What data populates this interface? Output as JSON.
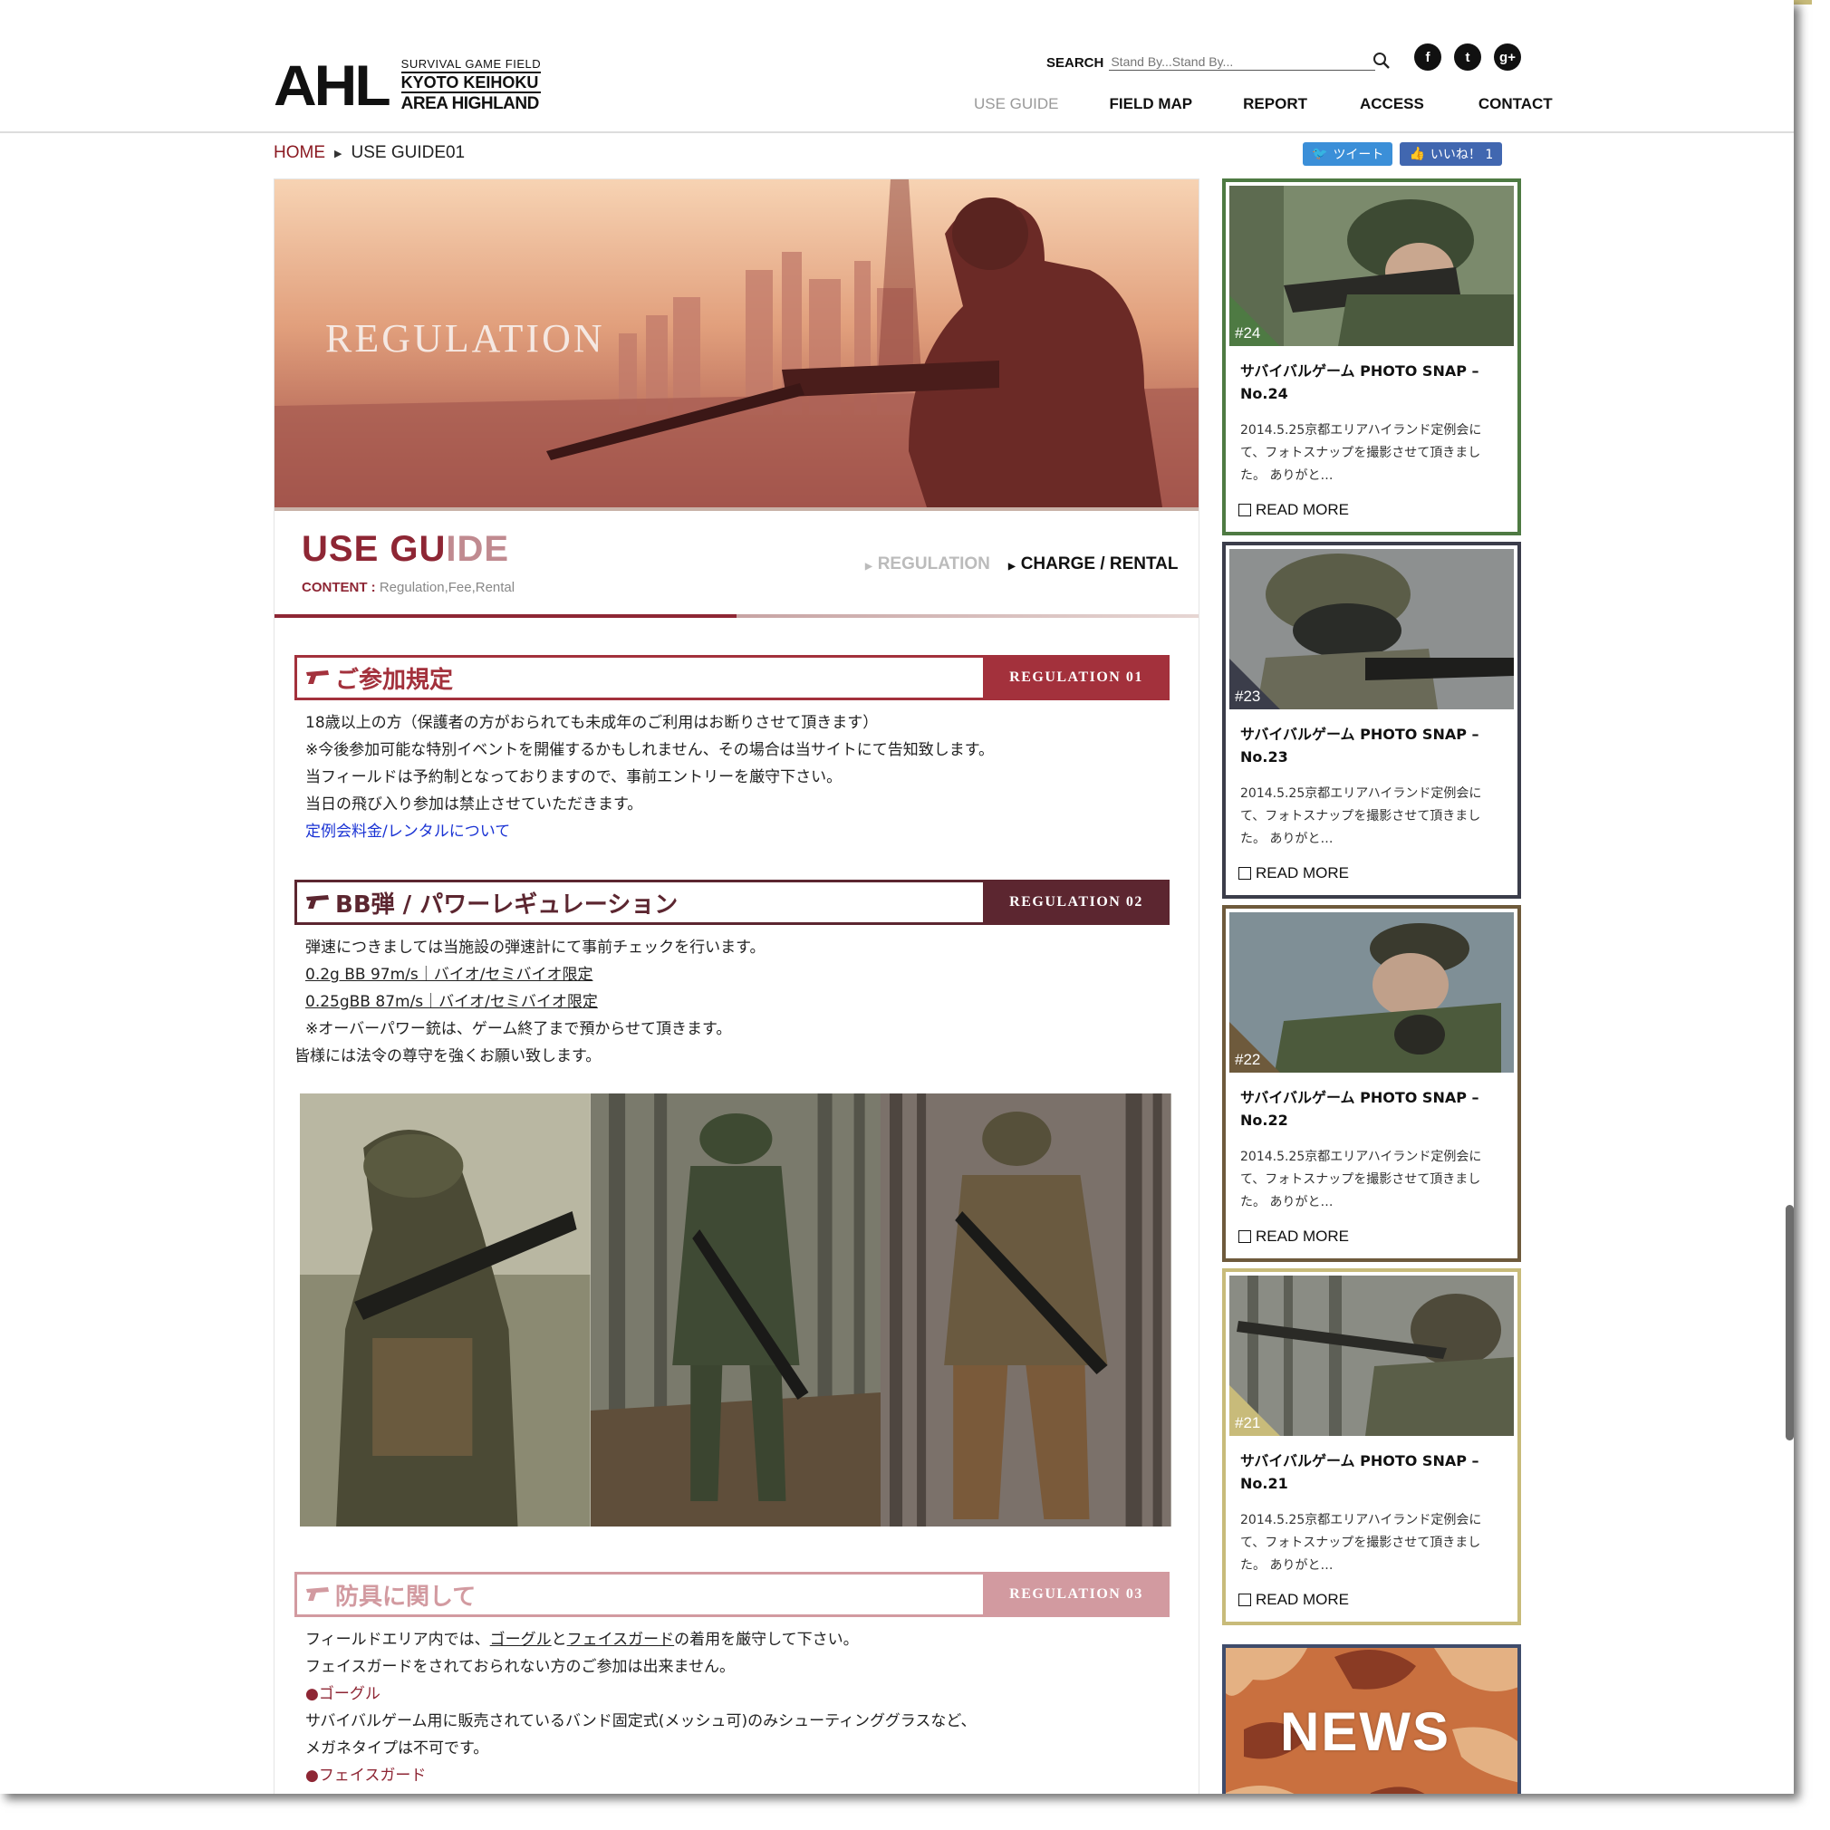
{
  "header": {
    "logo_main": "AHL",
    "logo_line1": "SURVIVAL GAME FIELD",
    "logo_line2": "KYOTO KEIHOKU",
    "logo_line3": "AREA HIGHLAND",
    "search_label": "SEARCH",
    "search_placeholder": "Stand By...Stand By...",
    "social": [
      "f",
      "t",
      "g+"
    ],
    "nav": [
      "USE GUIDE",
      "FIELD MAP",
      "REPORT",
      "ACCESS",
      "CONTACT"
    ]
  },
  "breadcrumb": {
    "home": "HOME",
    "current": "USE GUIDE01"
  },
  "share": {
    "tweet": "ツイート",
    "like": "いいね！ 1"
  },
  "hero": {
    "title": "REGULATION"
  },
  "guide": {
    "title_a": "USE GU",
    "title_b": "IDE",
    "content_label": "CONTENT :",
    "content_value": "Regulation,Fee,Rental",
    "tab1": "REGULATION",
    "tab2": "CHARGE / RENTAL"
  },
  "sections": [
    {
      "title": "ご参加規定",
      "tag": "REGULATION 01",
      "lines": [
        "18歳以上の方（保護者の方がおられても未成年のご利用はお断りさせて頂きます）",
        "※今後参加可能な特別イベントを開催するかもしれません、その場合は当サイトにて告知致します。",
        "当フィールドは予約制となっておりますので、事前エントリーを厳守下さい。",
        "当日の飛び入り参加は禁止させていただきます。"
      ],
      "link": "定例会料金/レンタルについて"
    },
    {
      "title": "BB弾 / パワーレギュレーション",
      "tag": "REGULATION 02",
      "line1": "弾速につきましては当施設の弾速計にて事前チェックを行います。",
      "line2": "0.2g BB 97m/s｜バイオ/セミバイオ限定",
      "line3": "0.25gBB 87m/s｜バイオ/セミバイオ限定",
      "line4": "※オーバーパワー銃は、ゲーム終了まで預からせて頂きます。",
      "line5": "皆様には法令の尊守を強くお願い致します。"
    },
    {
      "title": "防具に関して",
      "tag": "REGULATION 03",
      "l1a": "フィールドエリア内では、",
      "l1b": "ゴーグル",
      "l1c": "と",
      "l1d": "フェイスガード",
      "l1e": "の着用を厳守して下さい。",
      "l2": "フェイスガードをされておられない方のご参加は出来ません。",
      "h1": "●ゴーグル",
      "l3": "サバイバルゲーム用に販売されているバンド固定式(メッシュ可)のみシューティンググラスなど、",
      "l4": "メガネタイプは不可です。",
      "h2": "●フェイスガード"
    }
  ],
  "sidebar": [
    {
      "num": "#24",
      "title": "サバイバルゲーム PHOTO SNAP – No.24",
      "text": "2014.5.25京都エリアハイランド定例会にて、フォトスナップを撮影させて頂きました。 ありがと…",
      "more": "READ MORE",
      "color": "#4e7a43"
    },
    {
      "num": "#23",
      "title": "サバイバルゲーム PHOTO SNAP – No.23",
      "text": "2014.5.25京都エリアハイランド定例会にて、フォトスナップを撮影させて頂きました。 ありがと…",
      "more": "READ MORE",
      "color": "#3b3d4a"
    },
    {
      "num": "#22",
      "title": "サバイバルゲーム PHOTO SNAP – No.22",
      "text": "2014.5.25京都エリアハイランド定例会にて、フォトスナップを撮影させて頂きました。 ありがと…",
      "more": "READ MORE",
      "color": "#6e5a3c"
    },
    {
      "num": "#21",
      "title": "サバイバルゲーム PHOTO SNAP – No.21",
      "text": "2014.5.25京都エリアハイランド定例会にて、フォトスナップを撮影させて頂きました。 ありがと…",
      "more": "READ MORE",
      "color": "#c8bb7a"
    }
  ],
  "news": {
    "label": "NEWS"
  },
  "colors": {
    "accent": "#8e2634",
    "link": "#1a33d4"
  }
}
